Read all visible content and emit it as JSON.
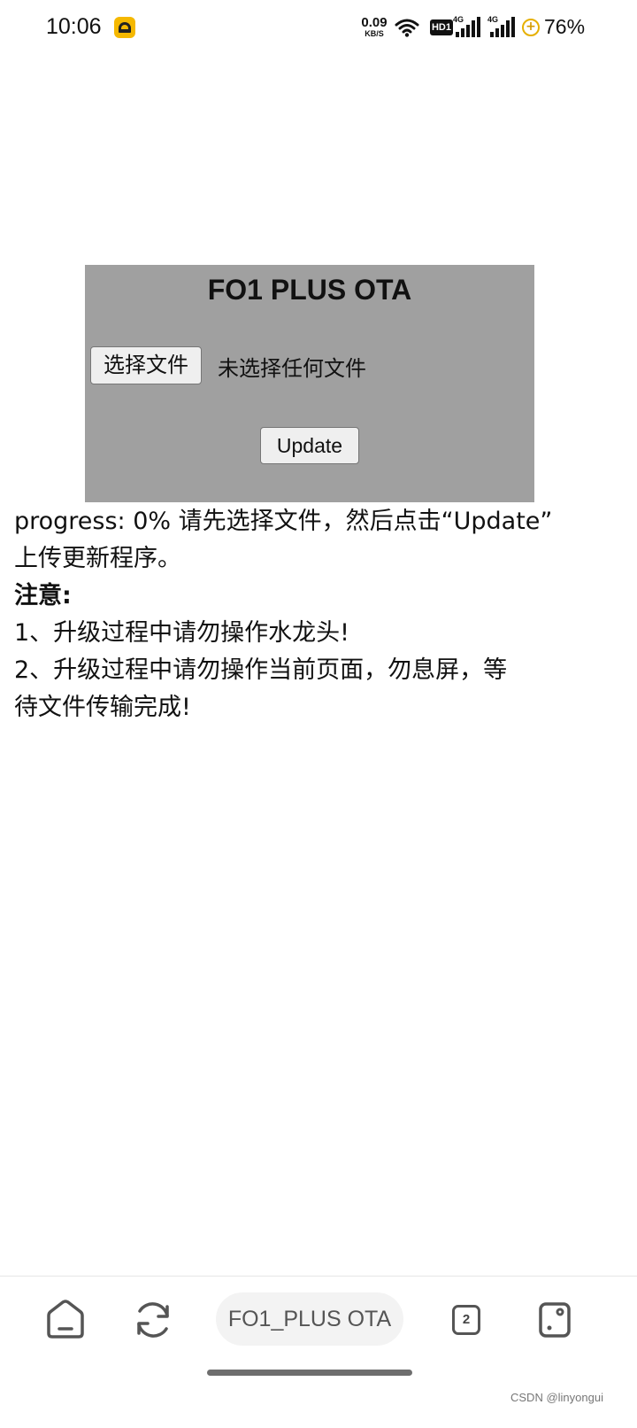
{
  "status_bar": {
    "time": "10:06",
    "net_speed_value": "0.09",
    "net_speed_unit": "KB/S",
    "hd_label": "HD1",
    "signal_1_label": "4G",
    "signal_2_label": "4G",
    "battery_text": "76%",
    "accent_color": "#f5b800"
  },
  "ota": {
    "title": "FO1 PLUS OTA",
    "file_button_label": "选择文件",
    "file_status": "未选择任何文件",
    "update_button_label": "Update",
    "panel_color": "#a0a0a0"
  },
  "info": {
    "progress_line_1": "progress: 0% 请先选择文件，然后点击“Update”",
    "progress_line_2": "上传更新程序。",
    "note_heading": "注意:",
    "note_1": "1、升级过程中请勿操作水龙头!",
    "note_2_line_1": "2、升级过程中请勿操作当前页面，勿息屏，等",
    "note_2_line_2": "待文件传输完成!"
  },
  "bottom_nav": {
    "url_text": "FO1_PLUS OTA",
    "tab_count": "2"
  },
  "watermark": "CSDN @linyongui"
}
